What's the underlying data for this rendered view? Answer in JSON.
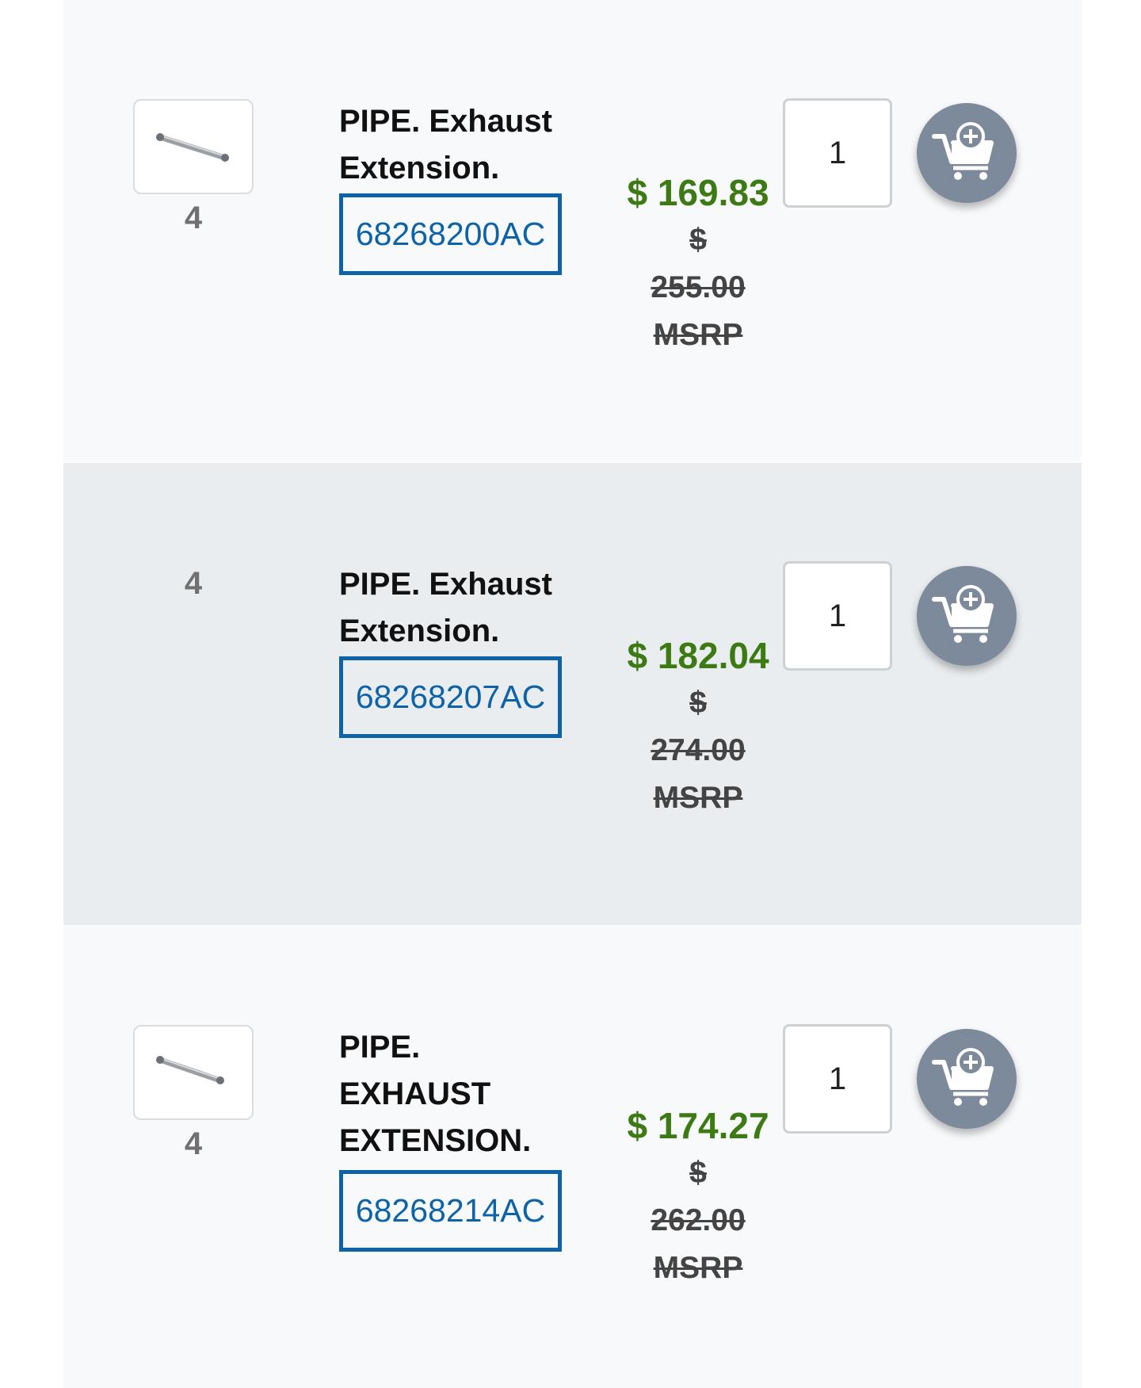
{
  "rows": [
    {
      "quantity_required": "4",
      "has_thumbnail": true,
      "description": "PIPE. Exhaust Extension.",
      "part_number": "68268200AC",
      "price": "$ 169.83",
      "msrp_currency": "$",
      "msrp_value": "255.00",
      "msrp_label": "MSRP",
      "quantity_value": "1",
      "cart_icon": "add-to-cart-icon"
    },
    {
      "quantity_required": "4",
      "has_thumbnail": false,
      "description": "PIPE. Exhaust Extension.",
      "part_number": "68268207AC",
      "price": "$ 182.04",
      "msrp_currency": "$",
      "msrp_value": "274.00",
      "msrp_label": "MSRP",
      "quantity_value": "1",
      "cart_icon": "add-to-cart-icon"
    },
    {
      "quantity_required": "4",
      "has_thumbnail": true,
      "description": "PIPE. EXHAUST EXTENSION.",
      "part_number": "68268214AC",
      "price": "$ 174.27",
      "msrp_currency": "$",
      "msrp_value": "262.00",
      "msrp_label": "MSRP",
      "quantity_value": "1",
      "cart_icon": "add-to-cart-icon"
    }
  ],
  "colors": {
    "row_background": "#f7f9fb",
    "row_alt_background": "#e9edef",
    "part_number_blue": "#0d62a8",
    "price_green": "#3d7a14",
    "cart_button_gray": "#7d8a9c"
  }
}
